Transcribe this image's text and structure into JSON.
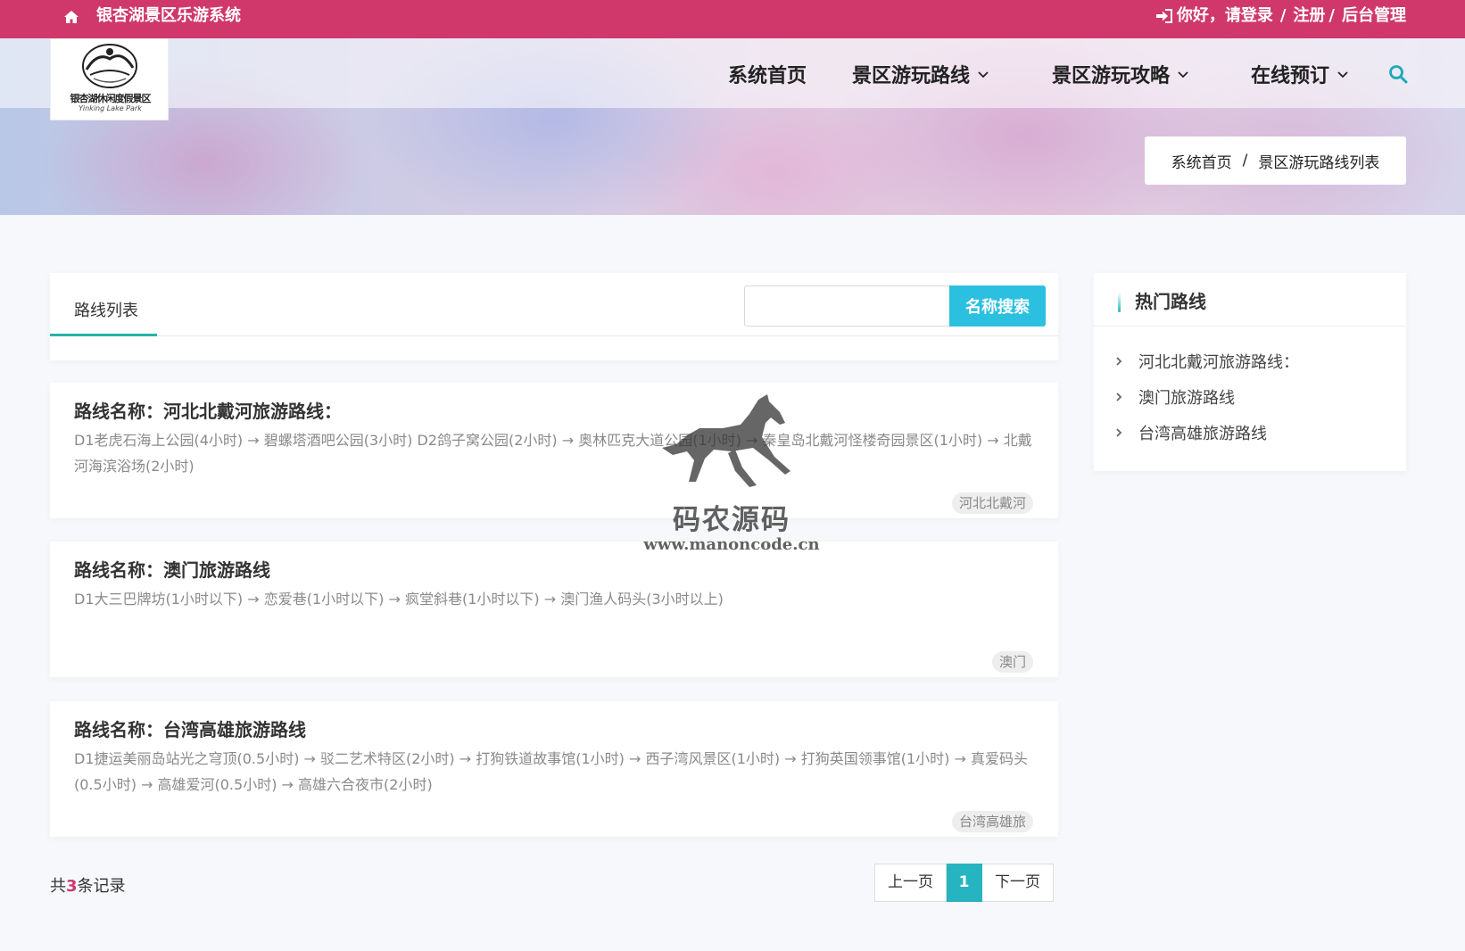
{
  "topbar": {
    "site_name": "银杏湖景区乐游系统",
    "greeting": "你好，请登录",
    "register": "注册",
    "admin": "后台管理",
    "sep1": "/",
    "sep2": "/",
    "bg_color": "#d0386b"
  },
  "logo": {
    "name": "银杏湖休闲度假景区",
    "sub": "Yinking Lake Park"
  },
  "nav": {
    "items": [
      {
        "label": "系统首页",
        "dropdown": false
      },
      {
        "label": "景区游玩路线",
        "dropdown": true
      },
      {
        "label": "景区游玩攻略",
        "dropdown": true
      },
      {
        "label": "在线预订",
        "dropdown": true
      }
    ],
    "search_icon": "search-icon"
  },
  "breadcrumb": {
    "home": "系统首页",
    "sep": "/",
    "current": "景区游玩路线列表"
  },
  "list": {
    "tab_label": "路线列表",
    "search_placeholder": "",
    "search_button": "名称搜索",
    "accent_color": "#26b5a5"
  },
  "routes": [
    {
      "title": "路线名称：河北北戴河旅游路线：",
      "desc": "D1老虎石海上公园(4小时) → 碧螺塔酒吧公园(3小时) D2鸽子窝公园(2小时) → 奥林匹克大道公园(1小时) → 秦皇岛北戴河怪楼奇园景区(1小时) → 北戴河海滨浴场(2小时)",
      "tag": "河北北戴河"
    },
    {
      "title": "路线名称：澳门旅游路线",
      "desc": "D1大三巴牌坊(1小时以下) → 恋爱巷(1小时以下) → 疯堂斜巷(1小时以下) → 澳门渔人码头(3小时以上)",
      "tag": "澳门"
    },
    {
      "title": "路线名称：台湾高雄旅游路线",
      "desc": "D1捷运美丽岛站光之穹顶(0.5小时) → 驳二艺术特区(2小时) → 打狗铁道故事馆(1小时) → 西子湾风景区(1小时) → 打狗英国领事馆(1小时) → 真爱码头(0.5小时) → 高雄爱河(0.5小时) → 高雄六合夜市(2小时)",
      "tag": "台湾高雄旅"
    }
  ],
  "summary": {
    "prefix": "共",
    "count": "3",
    "suffix": "条记录"
  },
  "pager": {
    "prev": "上一页",
    "current": "1",
    "next": "下一页"
  },
  "sidebar": {
    "title": "热门路线",
    "items": [
      "河北北戴河旅游路线：",
      "澳门旅游路线",
      "台湾高雄旅游路线"
    ]
  },
  "watermark": {
    "text": "码农源码",
    "url": "www.manoncode.cn"
  }
}
